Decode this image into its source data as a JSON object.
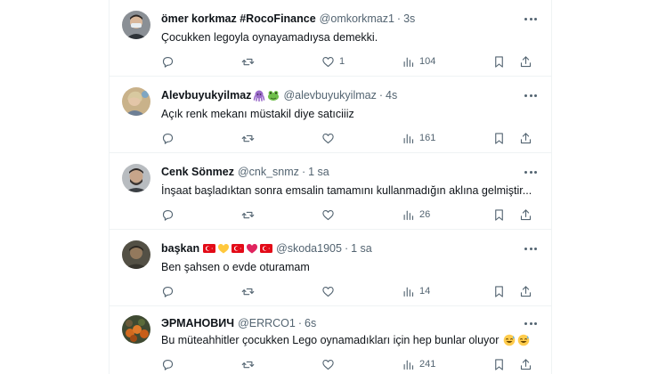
{
  "tweets": [
    {
      "name": "ömer korkmaz #RocoFinance",
      "handle": "@omkorkmaz1",
      "time": "3s",
      "text": "Çocukken legoyla oynayamadıysa demekki.",
      "likes": "1",
      "views": "104",
      "emojis": []
    },
    {
      "name": "Alevbuyukyilmaz",
      "handle": "@alevbuyukyilmaz",
      "time": "4s",
      "text": "Açık renk mekanı müstakil diye satıciiiz",
      "likes": "",
      "views": "161",
      "emojis": [
        "octopus-emoji",
        "frog-emoji"
      ]
    },
    {
      "name": "Cenk Sönmez",
      "handle": "@cnk_snmz",
      "time": "1 sa",
      "text": "İnşaat başladıktan sonra emsalin tamamını kullanmadığın aklına gelmiştir...",
      "likes": "",
      "views": "26",
      "emojis": []
    },
    {
      "name": "başkan",
      "handle": "@skoda1905",
      "time": "1 sa",
      "text": "Ben şahsen o evde oturamam",
      "likes": "",
      "views": "14",
      "emojis": [
        "turkey-flag-emoji",
        "yellow-heart-emoji",
        "turkey-flag-emoji",
        "red-heart-emoji",
        "turkey-flag-emoji"
      ]
    },
    {
      "name": "ЭРМАНОВИЧ",
      "handle": "@ERRCO1",
      "time": "6s",
      "text": "Bu müteahhitler çocukken Lego oynamadıkları için hep bunlar oluyor",
      "likes": "",
      "views": "241",
      "emojis": [
        "sweat-smile-emoji",
        "sweat-smile-emoji"
      ]
    }
  ],
  "colors": {
    "text": "#0f1419",
    "secondary": "#536471",
    "divider": "#eff3f4"
  }
}
